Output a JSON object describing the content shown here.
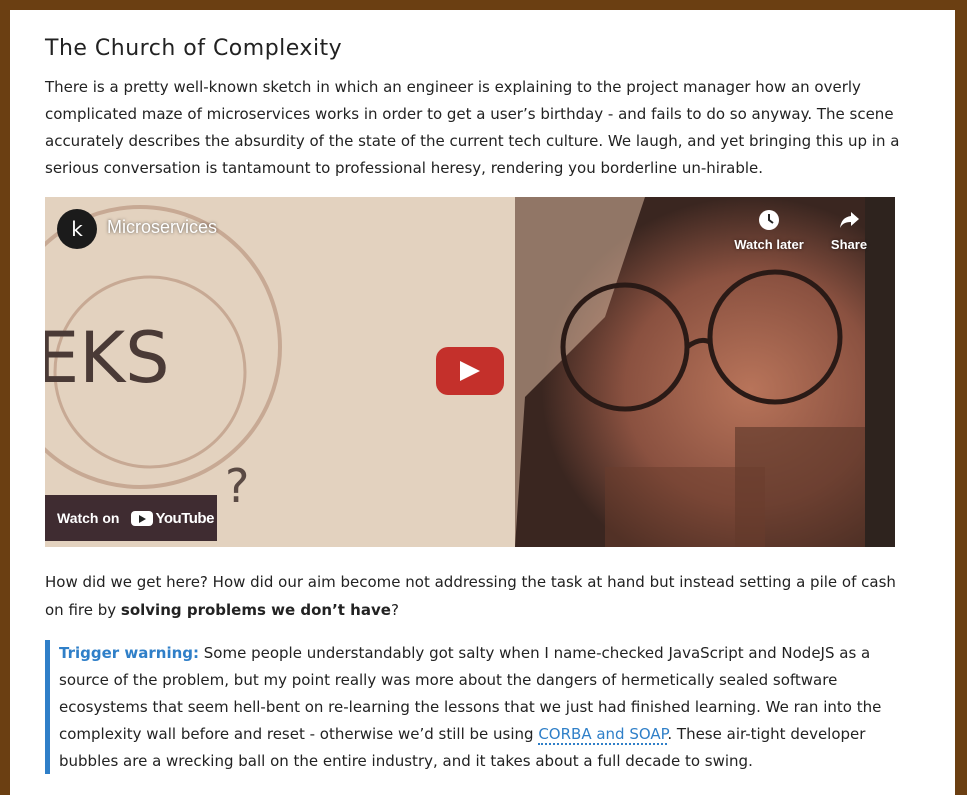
{
  "article": {
    "heading": "The Church of Complexity",
    "intro": "There is a pretty well-known sketch in which an engineer is explaining to the project manager how an overly complicated maze of microservices works in order to get a user’s birthday - and fails to do so anyway. The scene accurately describes the absurdity of the state of the current tech culture. We laugh, and yet bringing this up in a serious conversation is tantamount to professional heresy, rendering you borderline un-hirable.",
    "question_before": "How did we get here? How did our aim become not addressing the task at hand but instead setting a pile of cash on fire by ",
    "question_bold": "solving problems we don’t have",
    "question_after": "?"
  },
  "video": {
    "channel_letter": "k",
    "title": "Microservices",
    "watch_later": "Watch later",
    "share": "Share",
    "watch_on": "Watch on",
    "youtube": "YouTube",
    "board_text": "EKS"
  },
  "trigger": {
    "label": "Trigger warning:",
    "text1": " Some people understandably got salty when I name-checked JavaScript and NodeJS as a source of the problem, but my point really was more about the dangers of hermetically sealed software ecosystems that seem hell-bent on re-learning the lessons that we just had finished learning. We ran into the complexity wall before and reset - otherwise we’d still be using ",
    "link": "CORBA and SOAP",
    "text2": ". These air-tight developer bubbles are a wrecking ball on the entire industry, and it takes about a full decade to swing."
  },
  "colors": {
    "frame": "#6b3f12",
    "accent": "#2f7fc8",
    "play_button": "#c4302b"
  },
  "icons": [
    "clock-icon",
    "share-arrow-icon",
    "play-icon",
    "youtube-logo-icon"
  ]
}
